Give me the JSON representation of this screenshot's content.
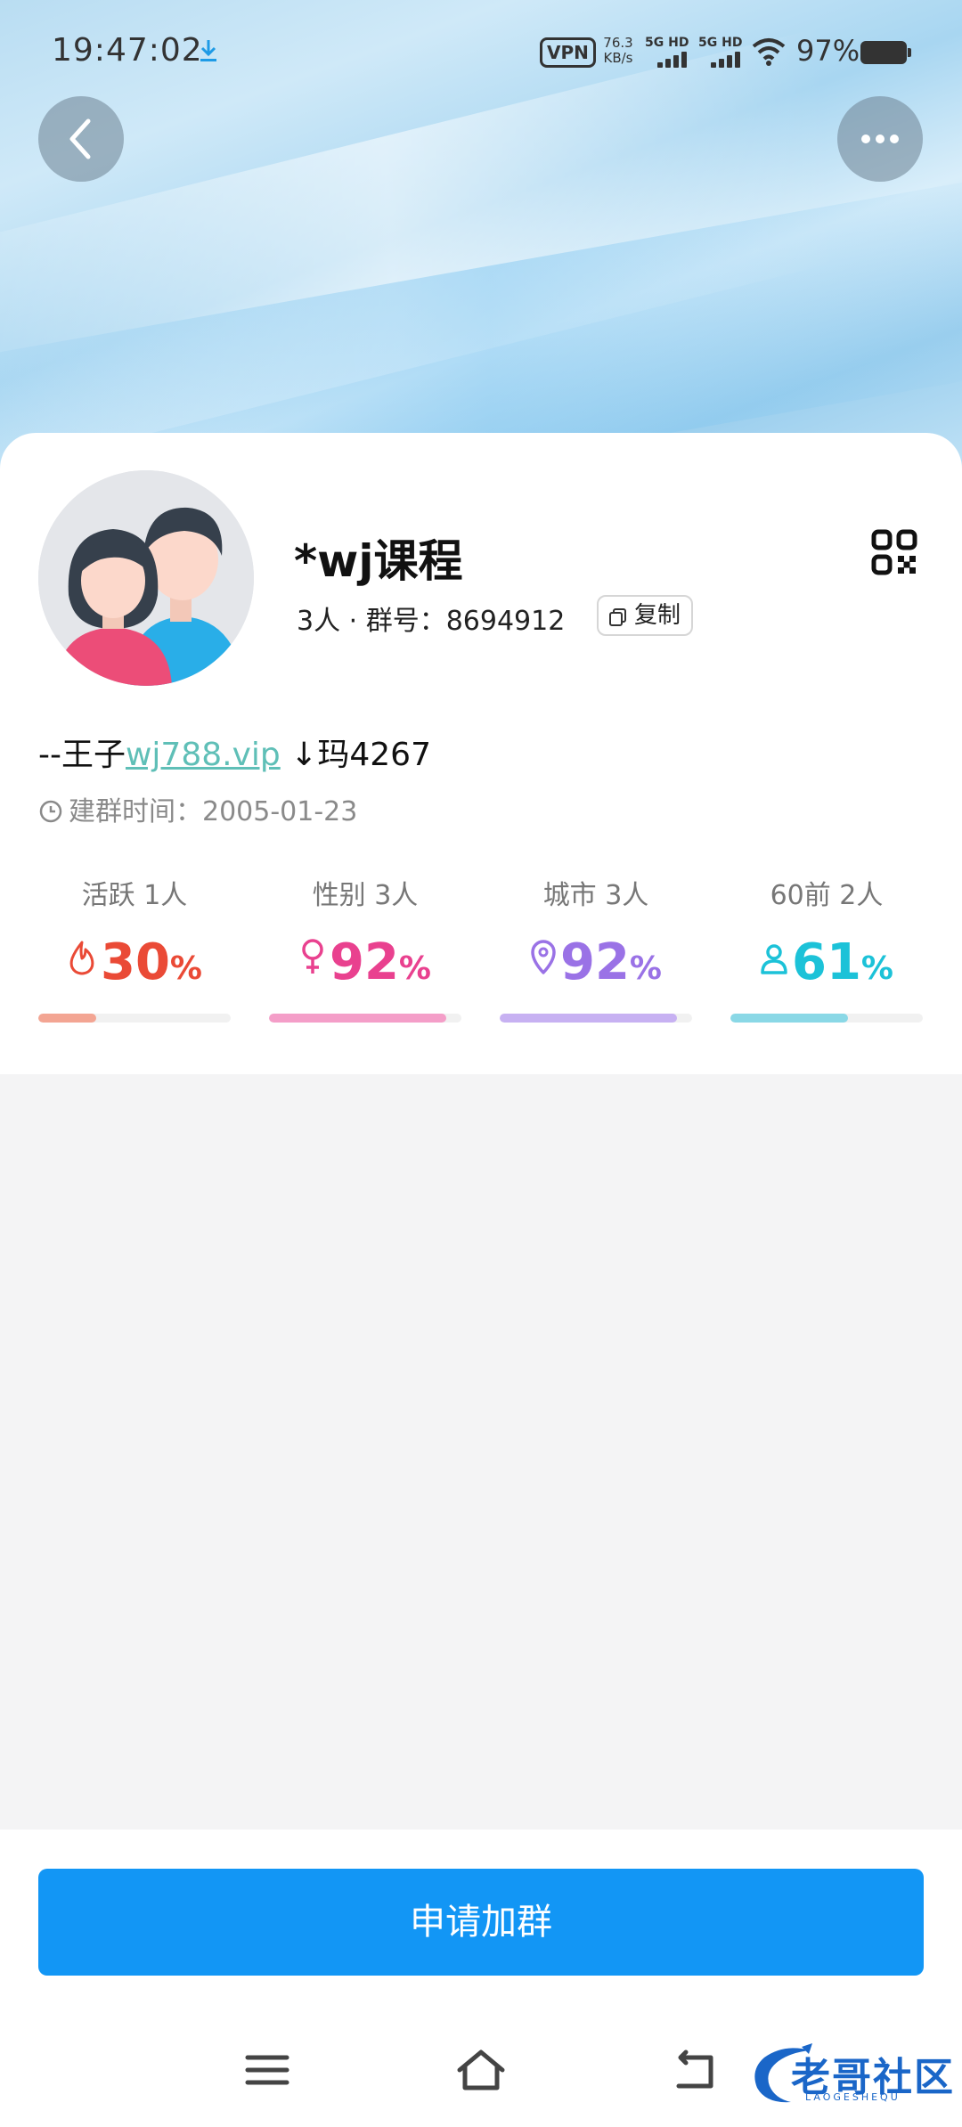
{
  "status_bar": {
    "time": "19:47:02",
    "vpn": "VPN",
    "net_speed_value": "76.3",
    "net_speed_unit": "KB/s",
    "sim1": "5G HD",
    "sim2": "5G HD",
    "battery": "97%"
  },
  "group": {
    "name": "*wj课程",
    "meta": "3人 · 群号：8694912",
    "copy_label": "复制",
    "intro_prefix": "--王子",
    "intro_link": "wj788.vip",
    "intro_suffix": " ↓玛4267",
    "created": "建群时间：2005-01-23"
  },
  "stats": [
    {
      "label": "活跃 1人",
      "value": "30",
      "unit": "%",
      "icon": "flame-icon",
      "color": "#ea4a36",
      "bar_color": "#f3a593",
      "level": 0.3
    },
    {
      "label": "性别 3人",
      "value": "92",
      "unit": "%",
      "icon": "female-icon",
      "color": "#e9418f",
      "bar_color": "#f49ec8",
      "level": 0.92
    },
    {
      "label": "城市 3人",
      "value": "92",
      "unit": "%",
      "icon": "location-pin-icon",
      "color": "#9a72e6",
      "bar_color": "#c7b1f2",
      "level": 0.92
    },
    {
      "label": "60前 2人",
      "value": "61",
      "unit": "%",
      "icon": "person-icon",
      "color": "#1cc2d8",
      "bar_color": "#8ad8e6",
      "level": 0.61
    }
  ],
  "actions": {
    "join": "申请加群"
  },
  "watermark": {
    "text": "老哥社区",
    "sub": "LAOGESHEQU"
  },
  "colors": {
    "primary_button": "#1296f5",
    "link": "#5fbfb7"
  }
}
